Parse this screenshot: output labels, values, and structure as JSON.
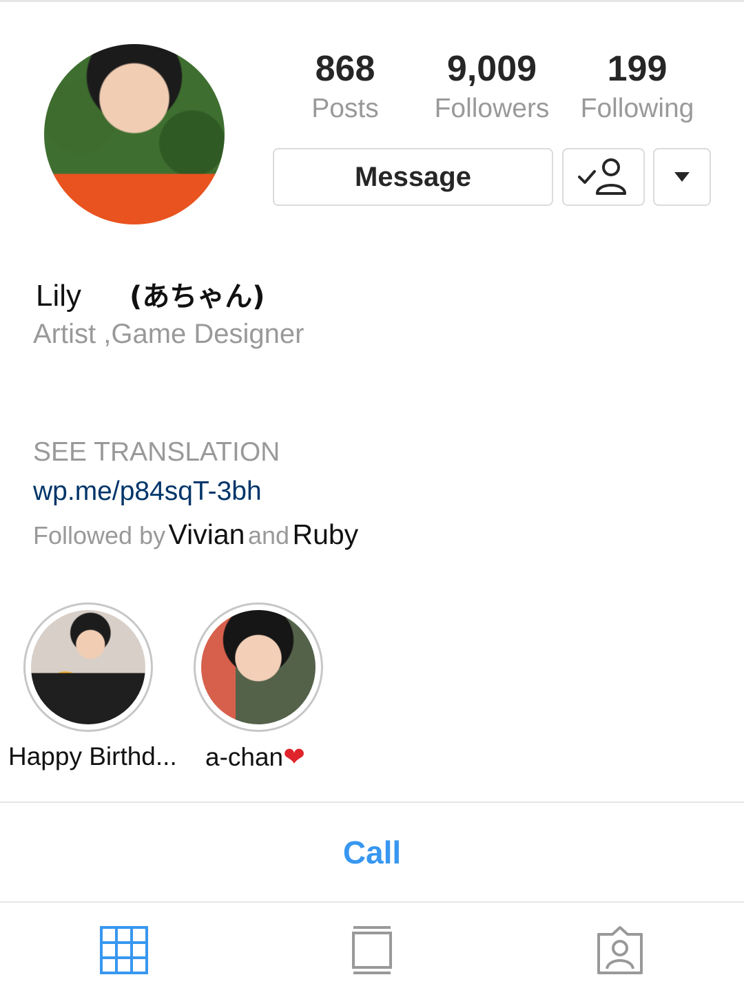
{
  "profile": {
    "name": "Lily",
    "name_jp": "(あちゃん)",
    "category": "Artist ,Game Designer",
    "see_translation": "SEE TRANSLATION",
    "link": "wp.me/p84sqT-3bh",
    "followed_by_prefix": "Followed by",
    "followed_by_user1": "Vivian",
    "followed_by_and": "and",
    "followed_by_user2": "Ruby"
  },
  "stats": {
    "posts": {
      "value": "868",
      "label": "Posts"
    },
    "followers": {
      "value": "9,009",
      "label": "Followers"
    },
    "following": {
      "value": "199",
      "label": "Following"
    }
  },
  "actions": {
    "message_label": "Message",
    "follow_icon": "person-check-icon",
    "more_icon": "caret-down-icon"
  },
  "highlights": [
    {
      "label": "Happy Birthd..."
    },
    {
      "label": "a-chan",
      "emoji": "❤"
    }
  ],
  "contact": {
    "call_label": "Call"
  },
  "tabs": [
    {
      "icon": "grid-icon",
      "active": true
    },
    {
      "icon": "feed-icon",
      "active": false
    },
    {
      "icon": "tagged-icon",
      "active": false
    }
  ],
  "colors": {
    "accent": "#3897f0",
    "link": "#003569",
    "muted": "#999999",
    "text": "#262626",
    "border": "#dbdbdb"
  }
}
